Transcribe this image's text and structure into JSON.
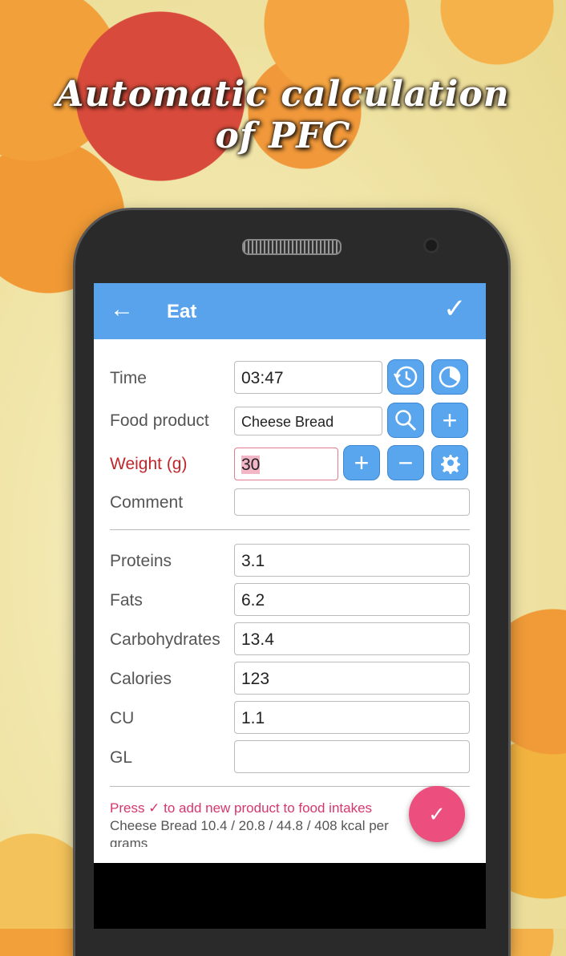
{
  "headline": {
    "line1": "Automatic calculation",
    "line2": "of PFC"
  },
  "appbar": {
    "back_icon": "←",
    "title": "Eat",
    "confirm_icon": "✓"
  },
  "form": {
    "time": {
      "label": "Time",
      "value": "03:47"
    },
    "food_product": {
      "label": "Food product",
      "value": "Cheese Bread"
    },
    "weight": {
      "label": "Weight (g)",
      "value": "30"
    },
    "comment": {
      "label": "Comment",
      "value": ""
    }
  },
  "nutrition": {
    "proteins": {
      "label": "Proteins",
      "value": "3.1"
    },
    "fats": {
      "label": "Fats",
      "value": "6.2"
    },
    "carbohydrates": {
      "label": "Carbohydrates",
      "value": "13.4"
    },
    "calories": {
      "label": "Calories",
      "value": "123"
    },
    "cu": {
      "label": "CU",
      "value": "1.1"
    },
    "gl": {
      "label": "GL",
      "value": ""
    }
  },
  "footer": {
    "hint": "Press ✓ to add new product to food intakes",
    "summary": "Cheese Bread  10.4 / 20.8 / 44.8 / 408 kcal per",
    "summary_cont": "grams",
    "fab_icon": "✓"
  },
  "icons": {
    "plus": "+",
    "minus": "−"
  },
  "colors": {
    "accent": "#59a3ec",
    "fab": "#ec4f7d",
    "warning_label": "#c0262a"
  }
}
